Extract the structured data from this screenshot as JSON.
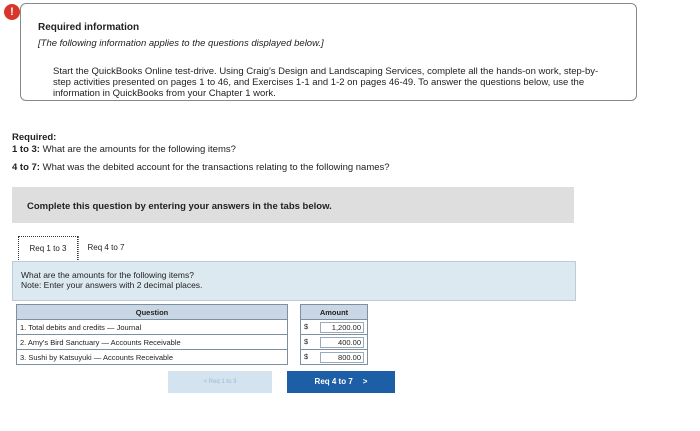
{
  "alert_icon": "!",
  "info": {
    "title": "Required information",
    "italic": "[The following information applies to the questions displayed below.]",
    "body": "Start the QuickBooks Online test-drive. Using Craig's Design and Landscaping Services, complete all the hands-on work, step-by-step activities presented on pages 1 to 46, and Exercises 1-1 and 1-2 on pages 46-49. To answer the questions below, use the information in QuickBooks from your Chapter 1 work."
  },
  "required": {
    "label": "Required:",
    "line1_bold": "1 to 3:",
    "line1_text": " What are the amounts for the following items?",
    "line2_bold": "4 to 7:",
    "line2_text": " What was the debited account for the transactions relating to the following names?"
  },
  "complete_text": "Complete this question by entering your answers in the tabs below.",
  "tabs": [
    {
      "label": "Req 1 to 3"
    },
    {
      "label": "Req 4 to 7"
    }
  ],
  "prompt": {
    "line1": "What are the amounts for the following items?",
    "line2": "Note: Enter your answers with 2 decimal places."
  },
  "table": {
    "question_header": "Question",
    "amount_header": "Amount",
    "currency": "$",
    "rows": [
      {
        "question": "1. Total debits and credits — Journal",
        "amount": "1,200.00"
      },
      {
        "question": "2. Amy's Bird Sanctuary — Accounts Receivable",
        "amount": "400.00"
      },
      {
        "question": "3. Sushi by Katsuyuki — Accounts Receivable",
        "amount": "800.00"
      }
    ]
  },
  "nav": {
    "prev_label": "Req 1 to 3",
    "next_label": "Req 4 to 7"
  }
}
